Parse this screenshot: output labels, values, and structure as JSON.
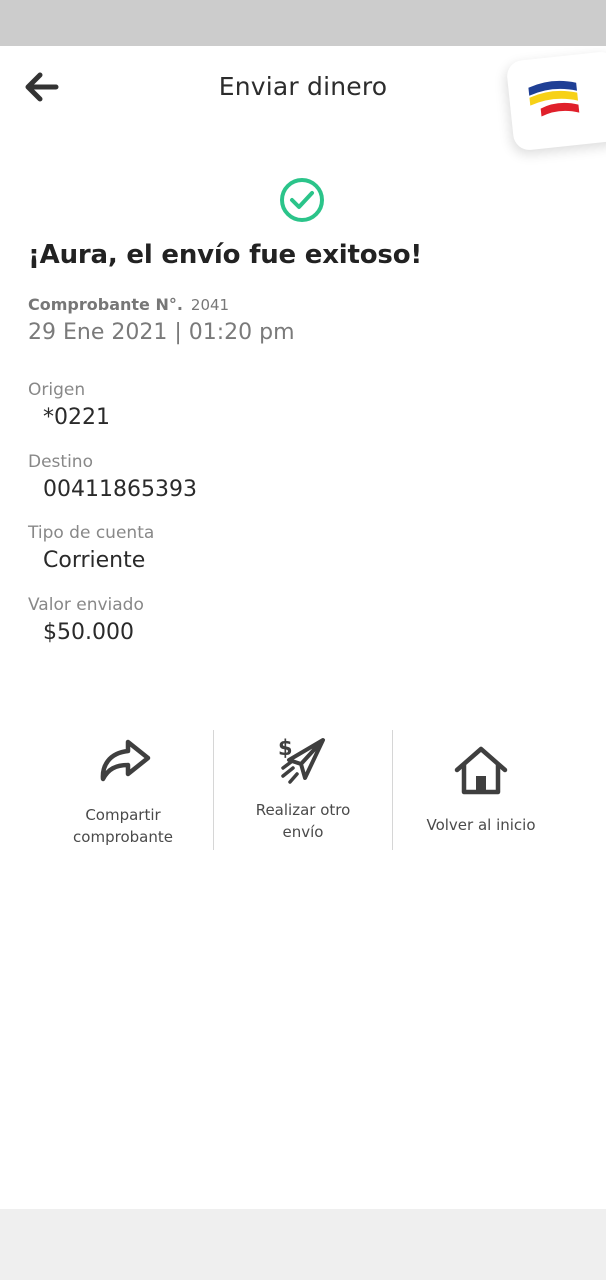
{
  "header": {
    "title": "Enviar dinero",
    "back_icon": "arrow-left-icon",
    "logo_icon": "bank-logo-flag-icon"
  },
  "success": {
    "icon": "check-circle-icon",
    "color": "#2bc48a",
    "headline": "¡Aura, el envío fue exitoso!"
  },
  "receipt": {
    "label": "Comprobante N°.",
    "number": "2041",
    "datetime": "29 Ene 2021 | 01:20 pm"
  },
  "details": [
    {
      "label": "Origen",
      "value": "*0221"
    },
    {
      "label": "Destino",
      "value": "00411865393"
    },
    {
      "label": "Tipo de cuenta",
      "value": "Corriente"
    },
    {
      "label": "Valor enviado",
      "value": "$50.000"
    }
  ],
  "actions": [
    {
      "icon": "share-icon",
      "label_line1": "Compartir",
      "label_line2": "comprobante"
    },
    {
      "icon": "send-money-icon",
      "label_line1": "Realizar otro",
      "label_line2": "envío"
    },
    {
      "icon": "home-icon",
      "label_line1": "Volver al inicio",
      "label_line2": ""
    }
  ],
  "colors": {
    "logo_blue": "#1f3f95",
    "logo_yellow": "#f7d117",
    "logo_red": "#e0202b",
    "status_bar": "#cccccc",
    "bottom_bar": "#efefef"
  }
}
